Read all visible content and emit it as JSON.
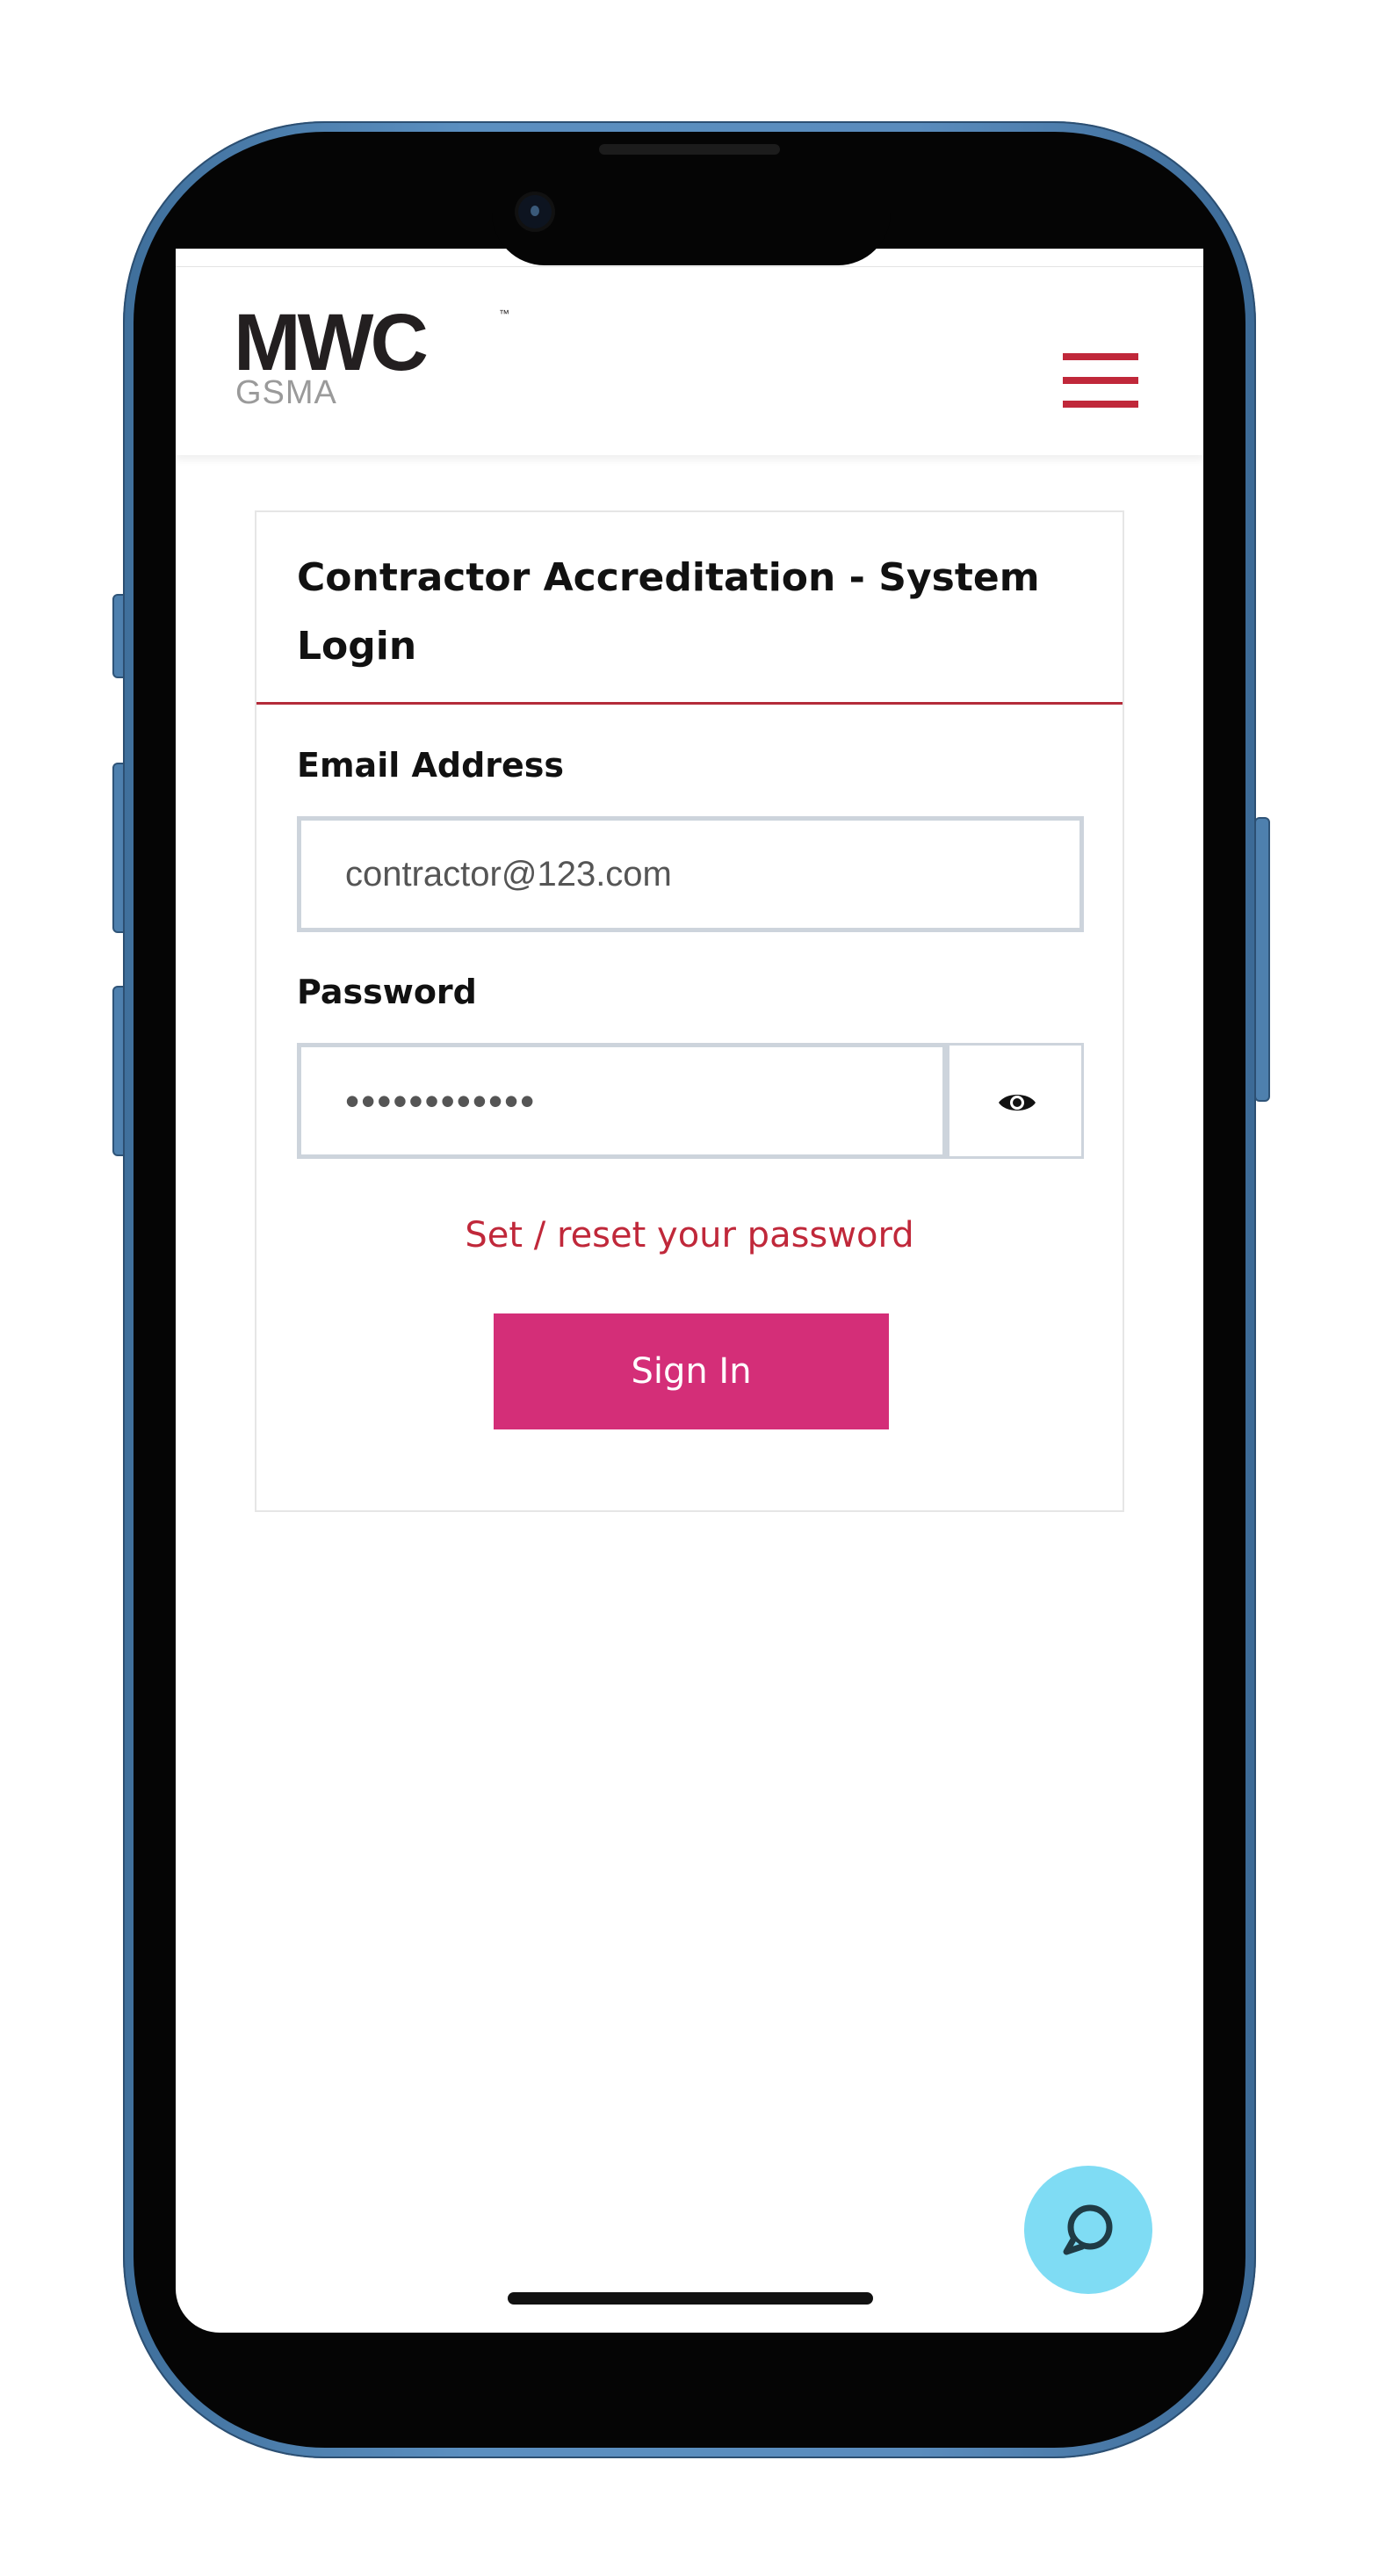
{
  "header": {
    "logo_main": "MWC",
    "logo_tm": "™",
    "logo_sub": "GSMA",
    "menu_icon": "hamburger-menu-icon"
  },
  "login": {
    "title": "Contractor Accreditation - System Login",
    "email_label": "Email Address",
    "email_value": "contractor@123.com",
    "password_label": "Password",
    "password_value": "••••••••••••",
    "show_password_icon": "eye-icon",
    "reset_link": "Set / reset your password",
    "signin_label": "Sign In"
  },
  "chat": {
    "icon": "chat-bubble-icon"
  },
  "colors": {
    "brand_red": "#c0283a",
    "signin_pink": "#d42e78",
    "chat_cyan": "#7fdcf4",
    "input_border": "#cdd4dc"
  }
}
